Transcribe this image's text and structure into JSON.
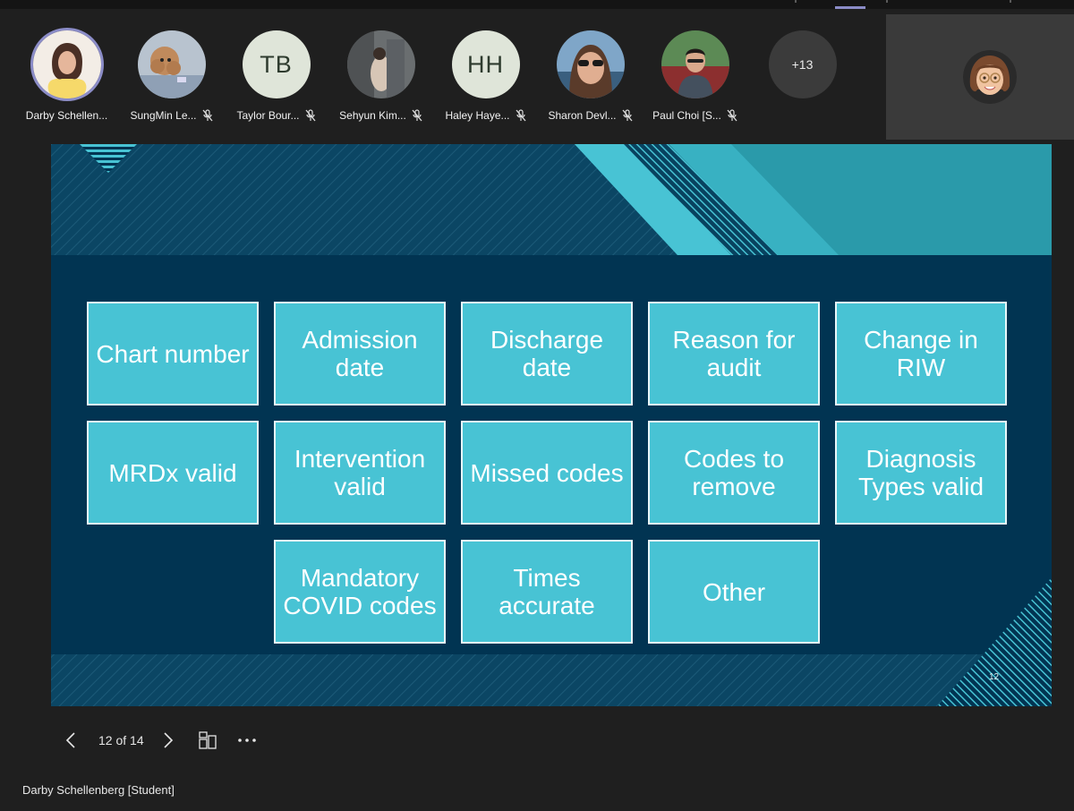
{
  "participants": [
    {
      "name": "Darby Schellen...",
      "type": "photo",
      "icon": "participant-photo",
      "speaking": true,
      "muted": false
    },
    {
      "name": "SungMin Le...",
      "type": "photo",
      "icon": "dog-photo",
      "muted": true
    },
    {
      "name": "Taylor Bour...",
      "type": "initials",
      "initials": "TB",
      "muted": true
    },
    {
      "name": "Sehyun Kim...",
      "type": "photo",
      "icon": "participant-photo",
      "muted": true
    },
    {
      "name": "Haley Haye...",
      "type": "initials",
      "initials": "HH",
      "muted": true
    },
    {
      "name": "Sharon Devl...",
      "type": "photo",
      "icon": "participant-photo",
      "muted": true
    },
    {
      "name": "Paul Choi [S...",
      "type": "photo",
      "icon": "participant-photo",
      "muted": true
    }
  ],
  "more_participants": "+13",
  "self_view": {
    "icon": "memoji-avatar"
  },
  "slide": {
    "tiles": [
      "Chart number",
      "Admission date",
      "Discharge date",
      "Reason for audit",
      "Change in RIW",
      "MRDx valid",
      "Intervention valid",
      "Missed codes",
      "Codes to remove",
      "Diagnosis Types valid",
      "Mandatory COVID codes",
      "Times accurate",
      "Other"
    ],
    "page_number": "12",
    "colors": {
      "navy": "#013452",
      "teal": "#48c3d4",
      "accent": "#2a9aaa"
    }
  },
  "controls": {
    "page_indicator": "12 of 14",
    "prev_icon": "chevron-left-icon",
    "next_icon": "chevron-right-icon",
    "grid_icon": "slide-grid-icon",
    "more_icon": "more-options-icon"
  },
  "presenter_name": "Darby Schellenberg [Student]"
}
